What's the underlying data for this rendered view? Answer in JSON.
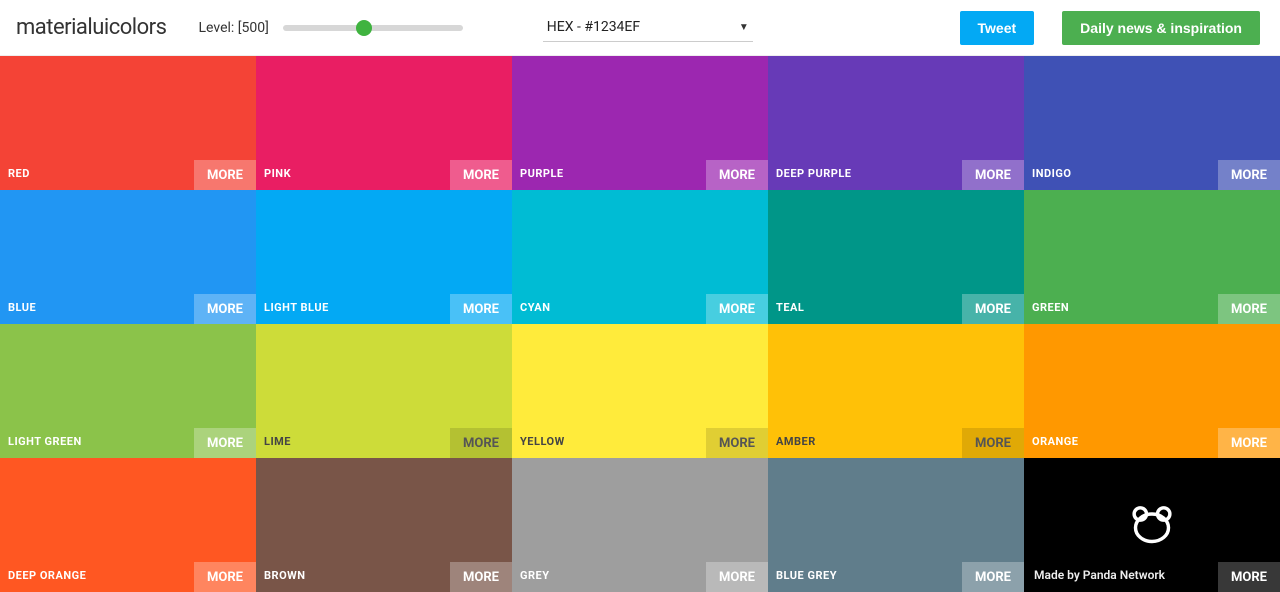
{
  "header": {
    "logo": "materialuicolors",
    "level_label": "Level: [500]",
    "format_select": "HEX - #1234EF",
    "tweet_label": "Tweet",
    "news_label": "Daily news & inspiration"
  },
  "more_label": "MORE",
  "footer": {
    "credit": "Made by Panda Network"
  },
  "swatches": [
    {
      "name": "RED",
      "hex": "#f44336",
      "dark": false
    },
    {
      "name": "PINK",
      "hex": "#e91e63",
      "dark": false
    },
    {
      "name": "PURPLE",
      "hex": "#9c27b0",
      "dark": false
    },
    {
      "name": "DEEP PURPLE",
      "hex": "#673ab7",
      "dark": false
    },
    {
      "name": "INDIGO",
      "hex": "#3f51b5",
      "dark": false
    },
    {
      "name": "BLUE",
      "hex": "#2196f3",
      "dark": false
    },
    {
      "name": "LIGHT BLUE",
      "hex": "#03a9f4",
      "dark": false
    },
    {
      "name": "CYAN",
      "hex": "#00bcd4",
      "dark": false
    },
    {
      "name": "TEAL",
      "hex": "#009688",
      "dark": false
    },
    {
      "name": "GREEN",
      "hex": "#4caf50",
      "dark": false
    },
    {
      "name": "LIGHT GREEN",
      "hex": "#8bc34a",
      "dark": false
    },
    {
      "name": "LIME",
      "hex": "#cddc39",
      "dark": true
    },
    {
      "name": "YELLOW",
      "hex": "#ffeb3b",
      "dark": true
    },
    {
      "name": "AMBER",
      "hex": "#ffc107",
      "dark": true
    },
    {
      "name": "ORANGE",
      "hex": "#ff9800",
      "dark": false
    },
    {
      "name": "DEEP ORANGE",
      "hex": "#ff5722",
      "dark": false
    },
    {
      "name": "BROWN",
      "hex": "#795548",
      "dark": false
    },
    {
      "name": "GREY",
      "hex": "#9e9e9e",
      "dark": false
    },
    {
      "name": "BLUE GREY",
      "hex": "#607d8b",
      "dark": false
    }
  ]
}
